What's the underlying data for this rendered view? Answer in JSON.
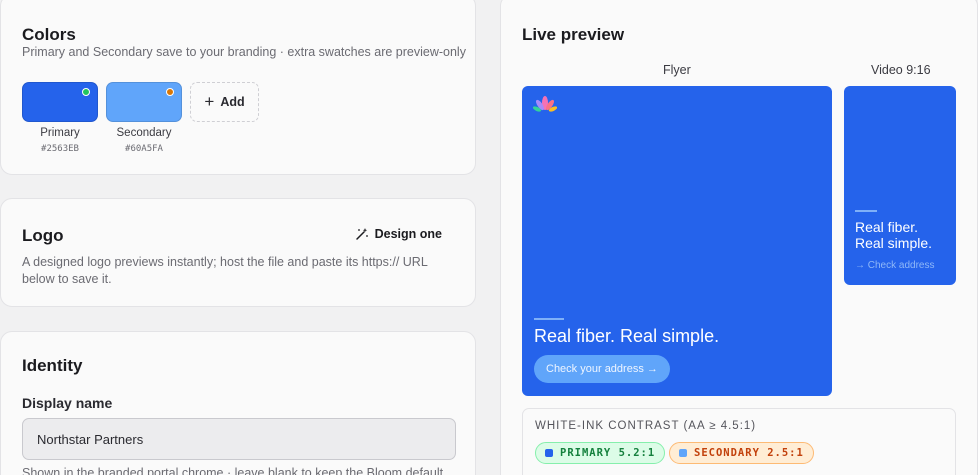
{
  "colors": {
    "title": "Colors",
    "description": "Primary and Secondary save to your branding · extra swatches are preview-only",
    "swatches": [
      {
        "label": "Primary",
        "hex": "#2563EB",
        "color": "#2563eb",
        "dot_color": "#22c55e"
      },
      {
        "label": "Secondary",
        "hex": "#60A5FA",
        "color": "#60a5fa",
        "dot_color": "#d97706"
      }
    ],
    "add_label": "Add"
  },
  "logo": {
    "title": "Logo",
    "design_label": "Design one",
    "description": "A designed logo previews instantly; host the file and paste its https:// URL below to save it."
  },
  "identity": {
    "title": "Identity",
    "display_name_label": "Display name",
    "display_name_value": "Northstar Partners",
    "display_name_help": "Shown in the branded portal chrome · leave blank to keep the Bloom default"
  },
  "preview": {
    "title": "Live preview",
    "flyer_label": "Flyer",
    "video_label": "Video 9:16",
    "flyer_headline": "Real fiber. Real simple.",
    "flyer_cta": "Check your address →",
    "video_headline_line1": "Real fiber.",
    "video_headline_line2": "Real simple.",
    "video_cta": "→ Check address",
    "contrast": {
      "title": "WHITE-INK CONTRAST (AA ≥ 4.5:1)",
      "primary": "PRIMARY 5.2:1",
      "secondary": "SECONDARY 2.5:1",
      "primary_color": "#2563eb",
      "secondary_color": "#60a5fa",
      "pass_bg": "#dcfce7",
      "pass_fg": "#15803d",
      "fail_bg": "#ffedd5",
      "fail_fg": "#c2410c"
    }
  }
}
